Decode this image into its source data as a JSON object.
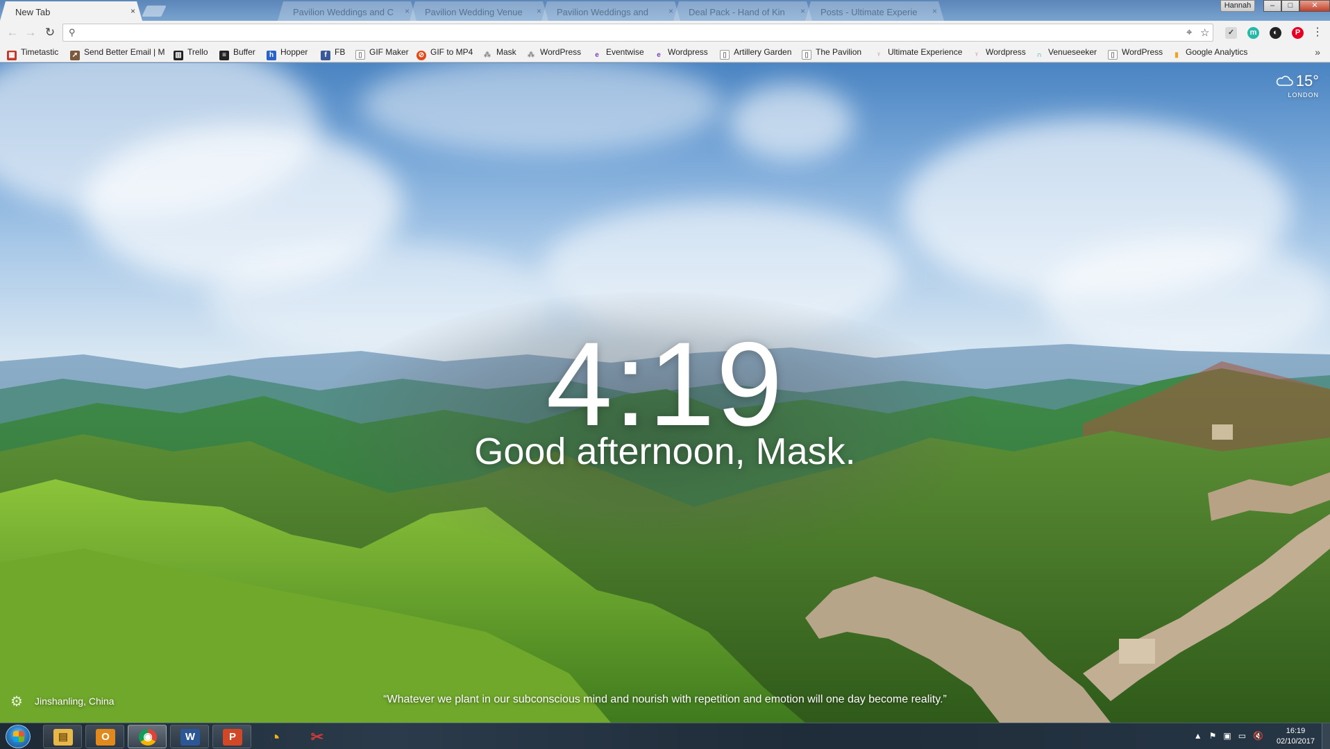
{
  "browser": {
    "active_tab": {
      "title": "New Tab",
      "close": "×"
    },
    "inactive_tabs": [
      {
        "title": "Pavilion Weddings and C",
        "close": "×"
      },
      {
        "title": "Pavilion Wedding Venue",
        "close": "×"
      },
      {
        "title": "Pavilion Weddings and",
        "close": "×"
      },
      {
        "title": "Deal Pack - Hand of Kin",
        "close": "×"
      },
      {
        "title": "Posts - Ultimate Experie",
        "close": "×"
      }
    ],
    "profile_name": "Hannah",
    "window_controls": {
      "minimize": "–",
      "maximize": "□",
      "close": "✕"
    }
  },
  "toolbar": {
    "back": "←",
    "forward": "→",
    "reload": "↻",
    "search_glyph": "⚲",
    "omnibox_value": "",
    "omnibox_placeholder": "",
    "location_icon": "⌖",
    "star_icon": "☆",
    "menu": "⋮",
    "extensions": [
      {
        "name": "pocket-icon",
        "glyph": "✓",
        "color": "#e0e0e0"
      },
      {
        "name": "mixmax-icon",
        "glyph": "m",
        "color": "#26b8a8"
      },
      {
        "name": "momentum-icon",
        "glyph": "◐",
        "color": "#222222"
      },
      {
        "name": "pinterest-icon",
        "glyph": "P",
        "color": "#e60023"
      }
    ]
  },
  "bookmarks": [
    {
      "label": "Timetastic",
      "icon": "calendar-icon",
      "glyph": "▦",
      "color": "#c0392b"
    },
    {
      "label": "Send Better Email | M",
      "icon": "rocket-icon",
      "glyph": "➚",
      "color": "#7a5a3a"
    },
    {
      "label": "Trello",
      "icon": "trello-icon",
      "glyph": "▥",
      "color": "#222222"
    },
    {
      "label": "Buffer",
      "icon": "buffer-icon",
      "glyph": "≡",
      "color": "#222222"
    },
    {
      "label": "Hopper",
      "icon": "hopper-icon",
      "glyph": "h",
      "color": "#2a62c9"
    },
    {
      "label": "FB",
      "icon": "facebook-icon",
      "glyph": "f",
      "color": "#3b5998"
    },
    {
      "label": "GIF Maker",
      "icon": "page-icon",
      "glyph": "▯",
      "color": "#9a9a9a"
    },
    {
      "label": "GIF to MP4",
      "icon": "ezgif-icon",
      "glyph": "⊘",
      "color": "#e24a1a"
    },
    {
      "label": "Mask",
      "icon": "mask-icon",
      "glyph": "⁂",
      "color": "#9a9a9a"
    },
    {
      "label": "WordPress",
      "icon": "mask-icon",
      "glyph": "⁂",
      "color": "#9a9a9a"
    },
    {
      "label": "Eventwise",
      "icon": "eventwise-icon",
      "glyph": "e",
      "color": "#7a3db8"
    },
    {
      "label": "Wordpress",
      "icon": "eventwise-icon",
      "glyph": "e",
      "color": "#7a3db8"
    },
    {
      "label": "Artillery Garden",
      "icon": "page-icon",
      "glyph": "▯",
      "color": "#9a9a9a"
    },
    {
      "label": "The Pavilion",
      "icon": "page-icon",
      "glyph": "▯",
      "color": "#9a9a9a"
    },
    {
      "label": "Ultimate Experience",
      "icon": "ue-icon",
      "glyph": "ᵞ",
      "color": "#d8a8c8"
    },
    {
      "label": "Wordpress",
      "icon": "ue-icon",
      "glyph": "ᵞ",
      "color": "#d8a8c8"
    },
    {
      "label": "Venueseeker",
      "icon": "venueseeker-icon",
      "glyph": "∩",
      "color": "#1aa3a3"
    },
    {
      "label": "WordPress",
      "icon": "page-icon",
      "glyph": "▯",
      "color": "#9a9a9a"
    },
    {
      "label": "Google Analytics",
      "icon": "analytics-icon",
      "glyph": "▮",
      "color": "#f4a21c"
    }
  ],
  "bookmarks_overflow": "»",
  "momentum": {
    "time": "4:19",
    "greeting": "Good afternoon, Mask.",
    "weather": {
      "temperature": "15°",
      "location": "LONDON"
    },
    "photo_location": "Jinshanling, China",
    "quote": "“Whatever we plant in our subconscious mind and nourish with repetition and emotion will one day become reality.”",
    "settings_icon": "⚙"
  },
  "taskbar": {
    "apps": [
      {
        "name": "file-explorer",
        "glyph": "▤",
        "color": "#e8b84a",
        "active": false
      },
      {
        "name": "outlook",
        "glyph": "O",
        "color": "#e08a1e",
        "active": false
      },
      {
        "name": "chrome",
        "glyph": "◉",
        "color": "#2f9d46",
        "active": true
      },
      {
        "name": "word",
        "glyph": "W",
        "color": "#2b5797",
        "active": false
      },
      {
        "name": "powerpoint",
        "glyph": "P",
        "color": "#d24726",
        "active": false
      },
      {
        "name": "pacman-app",
        "glyph": "◔",
        "color": "#f2b21a",
        "active": false
      },
      {
        "name": "snipping-tool",
        "glyph": "✂",
        "color": "#c03030",
        "active": false
      }
    ],
    "tray": [
      "▲",
      "⚑",
      "▣",
      "▭",
      "🔇"
    ],
    "clock_time": "16:19",
    "clock_date": "02/10/2017"
  }
}
